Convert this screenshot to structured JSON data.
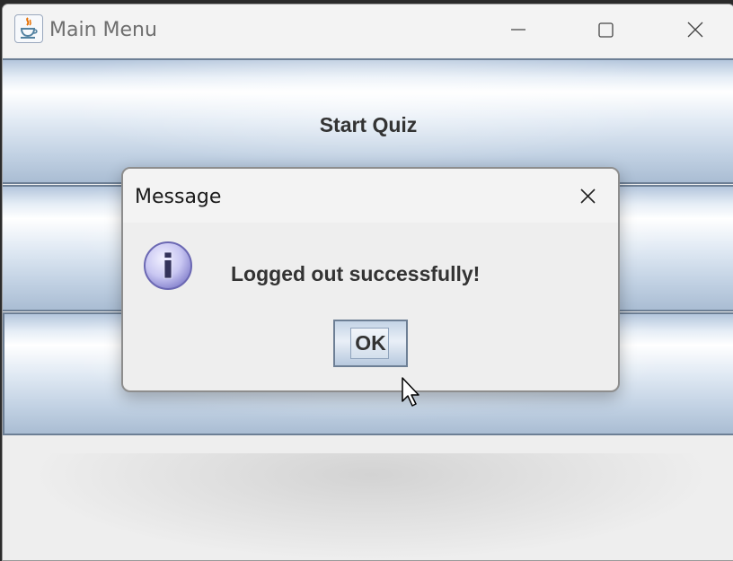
{
  "window": {
    "title": "Main Menu",
    "icon": "java-cup-icon",
    "controls": [
      "minimize-icon",
      "maximize-icon",
      "close-icon"
    ]
  },
  "menu": {
    "buttons": [
      {
        "label": "Start Quiz"
      },
      {
        "label": ""
      },
      {
        "label": ""
      }
    ]
  },
  "dialog": {
    "title": "Message",
    "message": "Logged out successfully!",
    "icon": "info-icon",
    "ok_label": "OK"
  },
  "colors": {
    "button_border": "#6d7f95",
    "button_text": "#333333",
    "info_icon_fill": "#c9c7f2"
  }
}
